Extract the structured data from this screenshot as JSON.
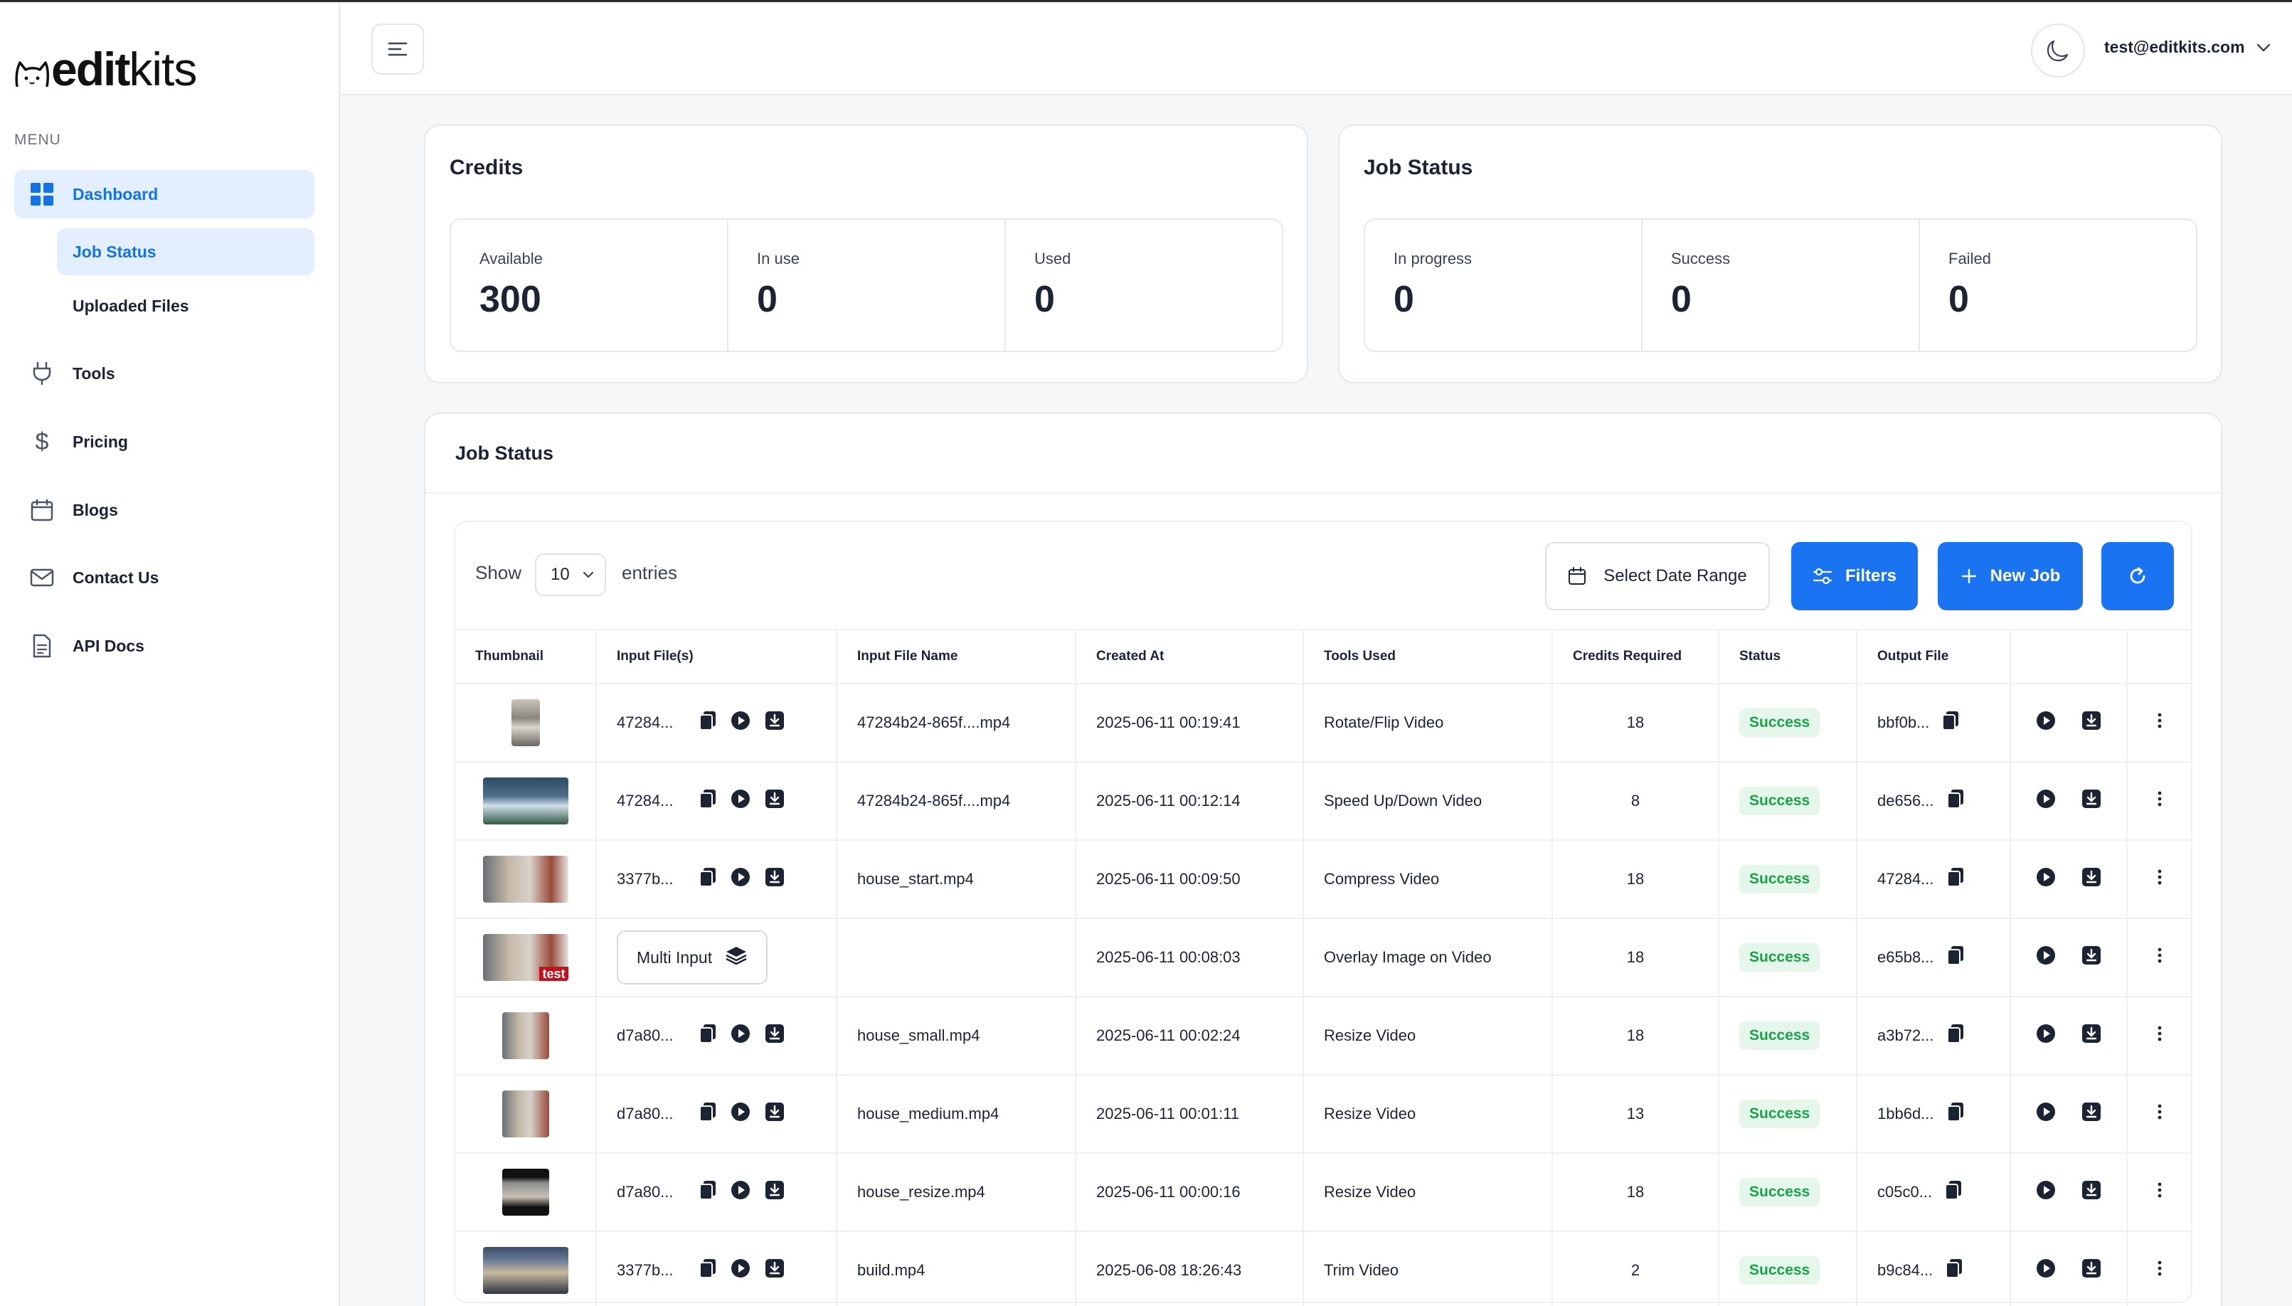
{
  "brand": {
    "logo_bold": "edit",
    "logo_light": "kits"
  },
  "sidebar": {
    "menu_label": "MENU",
    "items": [
      {
        "label": "Dashboard",
        "icon": "dashboard-grid-icon"
      },
      {
        "label": "Job Status"
      },
      {
        "label": "Uploaded Files"
      },
      {
        "label": "Tools",
        "icon": "plug-icon"
      },
      {
        "label": "Pricing",
        "icon": "dollar-icon"
      },
      {
        "label": "Blogs",
        "icon": "calendar-icon"
      },
      {
        "label": "Contact Us",
        "icon": "mail-icon"
      },
      {
        "label": "API Docs",
        "icon": "document-icon"
      }
    ]
  },
  "header": {
    "user_email": "test@editkits.com"
  },
  "credits": {
    "title": "Credits",
    "stats": [
      {
        "label": "Available",
        "value": "300"
      },
      {
        "label": "In use",
        "value": "0"
      },
      {
        "label": "Used",
        "value": "0"
      }
    ]
  },
  "job_status_summary": {
    "title": "Job Status",
    "stats": [
      {
        "label": "In progress",
        "value": "0"
      },
      {
        "label": "Success",
        "value": "0"
      },
      {
        "label": "Failed",
        "value": "0"
      }
    ]
  },
  "jobs": {
    "title": "Job Status",
    "show_label": "Show",
    "entries_value": "10",
    "entries_label": "entries",
    "date_range_label": "Select Date Range",
    "filters_label": "Filters",
    "new_job_label": "New Job",
    "columns": [
      "Thumbnail",
      "Input File(s)",
      "Input File Name",
      "Created At",
      "Tools Used",
      "Credits Required",
      "Status",
      "Output File",
      "",
      ""
    ],
    "multi_input_label": "Multi Input",
    "rows": [
      {
        "input": "47284...",
        "file_name": "47284b24-865f....mp4",
        "created": "2025-06-11 00:19:41",
        "tool": "Rotate/Flip Video",
        "credits": "18",
        "status": "Success",
        "output": "bbf0b..."
      },
      {
        "input": "47284...",
        "file_name": "47284b24-865f....mp4",
        "created": "2025-06-11 00:12:14",
        "tool": "Speed Up/Down Video",
        "credits": "8",
        "status": "Success",
        "output": "de656..."
      },
      {
        "input": "3377b...",
        "file_name": "house_start.mp4",
        "created": "2025-06-11 00:09:50",
        "tool": "Compress Video",
        "credits": "18",
        "status": "Success",
        "output": "47284..."
      },
      {
        "input": "",
        "file_name": "",
        "created": "2025-06-11 00:08:03",
        "tool": "Overlay Image on Video",
        "credits": "18",
        "status": "Success",
        "output": "e65b8...",
        "thumb_label": "test"
      },
      {
        "input": "d7a80...",
        "file_name": "house_small.mp4",
        "created": "2025-06-11 00:02:24",
        "tool": "Resize Video",
        "credits": "18",
        "status": "Success",
        "output": "a3b72..."
      },
      {
        "input": "d7a80...",
        "file_name": "house_medium.mp4",
        "created": "2025-06-11 00:01:11",
        "tool": "Resize Video",
        "credits": "13",
        "status": "Success",
        "output": "1bb6d..."
      },
      {
        "input": "d7a80...",
        "file_name": "house_resize.mp4",
        "created": "2025-06-11 00:00:16",
        "tool": "Resize Video",
        "credits": "18",
        "status": "Success",
        "output": "c05c0..."
      },
      {
        "input": "3377b...",
        "file_name": "build.mp4",
        "created": "2025-06-08 18:26:43",
        "tool": "Trim Video",
        "credits": "2",
        "status": "Success",
        "output": "b9c84..."
      }
    ]
  },
  "colors": {
    "accent": "#1a73f0",
    "active_bg": "#e3eeff",
    "success": "#1aa14a",
    "success_bg": "#e4f7ea"
  }
}
